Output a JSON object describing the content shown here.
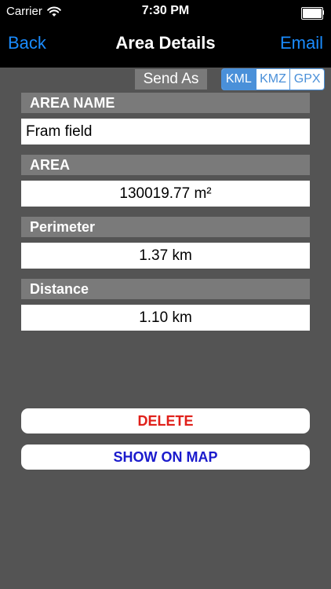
{
  "status_bar": {
    "carrier": "Carrier",
    "time": "7:30 PM"
  },
  "nav": {
    "back_label": "Back",
    "title": "Area Details",
    "email_label": "Email"
  },
  "send_as": {
    "label": "Send As",
    "options": [
      "KML",
      "KMZ",
      "GPX"
    ],
    "selected": "KML"
  },
  "fields": {
    "area_name": {
      "label": "AREA NAME",
      "value": "Fram field"
    },
    "area": {
      "label": "AREA",
      "value": "130019.77 m²"
    },
    "perimeter": {
      "label": "Perimeter",
      "value": "1.37 km"
    },
    "distance": {
      "label": "Distance",
      "value": "1.10 km"
    }
  },
  "actions": {
    "delete_label": "DELETE",
    "show_on_map_label": "SHOW ON MAP"
  },
  "colors": {
    "accent": "#1a8cff",
    "segment": "#4a90d9",
    "delete": "#e0201a",
    "show_on_map": "#1a1acc",
    "background": "#545454",
    "header_bg": "#7a7a7a"
  },
  "icons": {
    "wifi": "wifi-icon",
    "battery": "battery-icon"
  }
}
